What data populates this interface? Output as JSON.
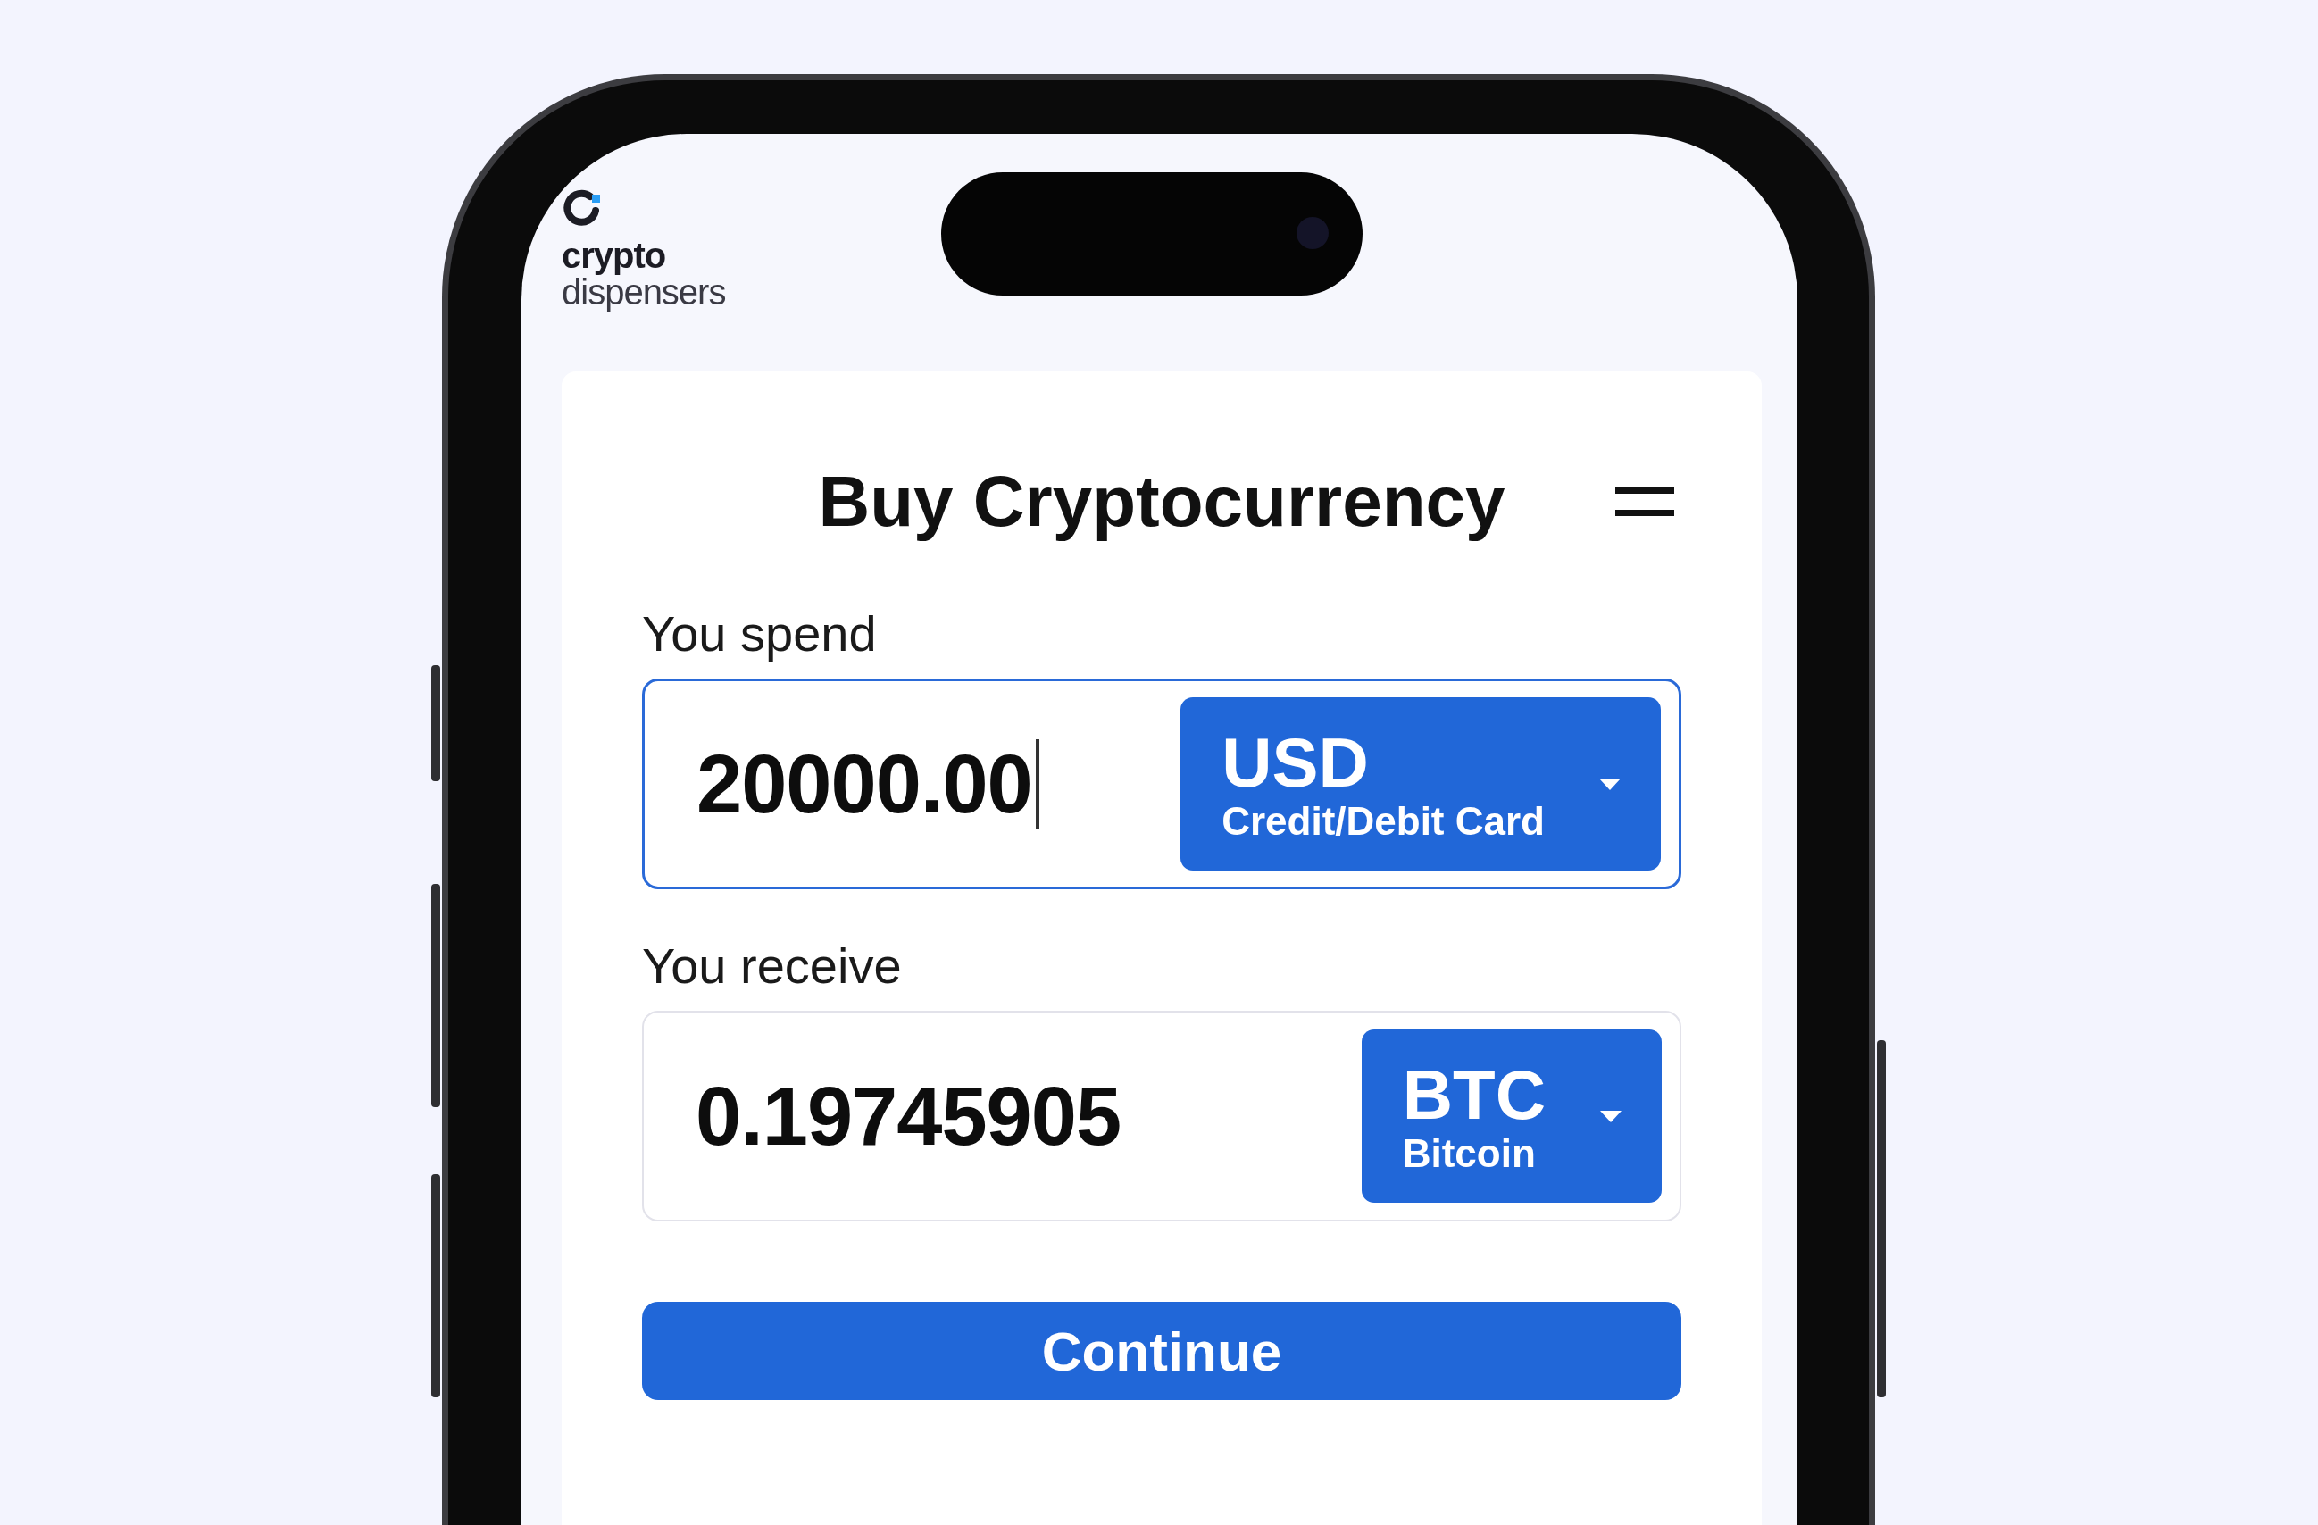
{
  "logo": {
    "line_1": "crypto",
    "line_2": "dispensers"
  },
  "title": "Buy Cryptocurrency",
  "fields": [
    {
      "label": "You spend",
      "value": "20000.00",
      "focused": true,
      "currency": {
        "code": "USD",
        "name": "Credit/Debit Card"
      }
    },
    {
      "label": "You receive",
      "value": "0.19745905",
      "focused": false,
      "currency": {
        "code": "BTC",
        "name": "Bitcoin"
      }
    }
  ],
  "primary_button": "Continue"
}
